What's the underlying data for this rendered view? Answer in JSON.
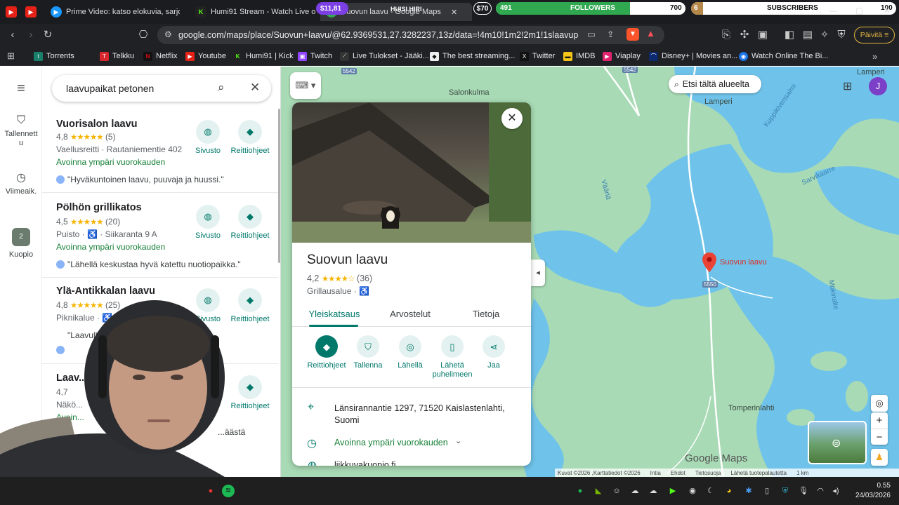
{
  "titlebar": {
    "tabs": [
      {
        "label": "Prime Video: katso elokuvia, sarjoja, ..."
      },
      {
        "label": "Humi91 Stream - Watch Live on Kick"
      },
      {
        "label": "Suovun laavu - Google Maps"
      }
    ],
    "overlay": {
      "money1": "$11,81",
      "huisi": "HUISI HIRI",
      "money2": "$70",
      "followers_count": "491",
      "followers_label": "FOLLOWERS",
      "followers_goal": "700",
      "subs_count": "6",
      "subs_label": "SUBSCRIBERS",
      "subs_goal": "100"
    }
  },
  "toolbar": {
    "url": "google.com/maps/place/Suovun+laavu/@62.9369531,27.3282237,13z/data=!4m10!1m2!2m1!1slaavupaikat+...",
    "update_label": "Päivitä"
  },
  "bookmarks": [
    {
      "label": "Torrents"
    },
    {
      "label": "Telkku"
    },
    {
      "label": "Netflix"
    },
    {
      "label": "Youtube"
    },
    {
      "label": "Humi91 | Kick"
    },
    {
      "label": "Twitch"
    },
    {
      "label": "Live Tulokset - Jääki..."
    },
    {
      "label": "The best streaming..."
    },
    {
      "label": "Twitter"
    },
    {
      "label": "IMDB"
    },
    {
      "label": "Viaplay"
    },
    {
      "label": "Disney+ | Movies an..."
    },
    {
      "label": "Watch Online The Bi..."
    }
  ],
  "rail": {
    "saved": "Tallennettu",
    "recent": "Viimeaik.",
    "kuopio": "Kuopio",
    "kuopio_badge": "2"
  },
  "search": {
    "query": "laavupaikat petonen"
  },
  "results": [
    {
      "name": "Vuorisalon laavu",
      "rating": "4,8",
      "stars": "★★★★★",
      "count": "(5)",
      "type": "Vaellusreitti · Rautaniementie 402",
      "open": "Avoinna ympäri vuorokauden",
      "review": "\"Hyväkuntoinen laavu, puuvaja ja huussi.\"",
      "website": "Sivusto",
      "directions": "Reittiohjeet"
    },
    {
      "name": "Pölhön grillikatos",
      "rating": "4,5",
      "stars": "★★★★★",
      "count": "(20)",
      "type": "Puisto · ♿ · Siikaranta 9 A",
      "open": "Avoinna ympäri vuorokauden",
      "review": "\"Lähellä keskustaa hyvä katettu nuotiopaikka.\"",
      "website": "Sivusto",
      "directions": "Reittiohjeet"
    },
    {
      "name": "Ylä-Antikkalan laavu",
      "rating": "4,8",
      "stars": "★★★★★",
      "count": "(25)",
      "type": "Piknikalue · ♿",
      "open": "",
      "review": "\"Laavulla ... alkokatos ja puuc...",
      "website": "Sivusto",
      "directions": "Reittiohjeet"
    },
    {
      "name": "Laav...",
      "rating": "4,7",
      "stars": "",
      "count": "",
      "type": "Näkö...",
      "open": "Avoin...",
      "review": "...äästä",
      "website": "",
      "directions": "Reittiohjeet"
    }
  ],
  "map": {
    "search_area": "Etsi tältä alueelta",
    "avatar_letter": "J",
    "labels": {
      "salonkulma": "Salonkulma",
      "lamperi_top": "Lamperi",
      "lamperi": "Lamperi",
      "tomperinlahti": "Tomperinlahti",
      "pin_label": "Suovun laavu",
      "road1": "5542",
      "road2": "5542",
      "road3": "5550"
    },
    "water_labels": {
      "kuppi": "Kuppikivensalmi",
      "vaara": "Vääriä",
      "sarvi": "Sarvikaarre",
      "mokin": "Mökinalte"
    },
    "attribution": {
      "brand": "Google Maps",
      "imagery": "Kuvat ©2026 ,Karttatiedot ©2026",
      "india": "Intia",
      "terms": "Ehdot",
      "privacy": "Tietosuoja",
      "feedback": "Lähetä tuotepalautetta",
      "scale": "1 km"
    }
  },
  "place": {
    "name": "Suovun laavu",
    "rating": "4,2",
    "stars": "★★★★☆",
    "count": "(36)",
    "category": "Grillausalue · ♿",
    "tabs": [
      {
        "label": "Yleiskatsaus"
      },
      {
        "label": "Arvostelut"
      },
      {
        "label": "Tietoja"
      }
    ],
    "actions": [
      {
        "label": "Reittiohjeet"
      },
      {
        "label": "Tallenna"
      },
      {
        "label": "Lähellä"
      },
      {
        "label": "Lähetä puhelimeen"
      },
      {
        "label": "Jaa"
      }
    ],
    "address": "Länsirannantie 1297, 71520 Kaislastenlahti, Suomi",
    "hours": "Avoinna ympäri vuorokauden",
    "website": "liikkuvakuopio.fi"
  },
  "taskbar": {
    "time": "0.55",
    "date": "24/03/2026"
  },
  "colors": {
    "accent": "#00796b",
    "open_green": "#188038",
    "star": "#f5b400",
    "map_land": "#a8dab5",
    "map_water": "#6fc3ea",
    "pin": "#ea4335"
  }
}
